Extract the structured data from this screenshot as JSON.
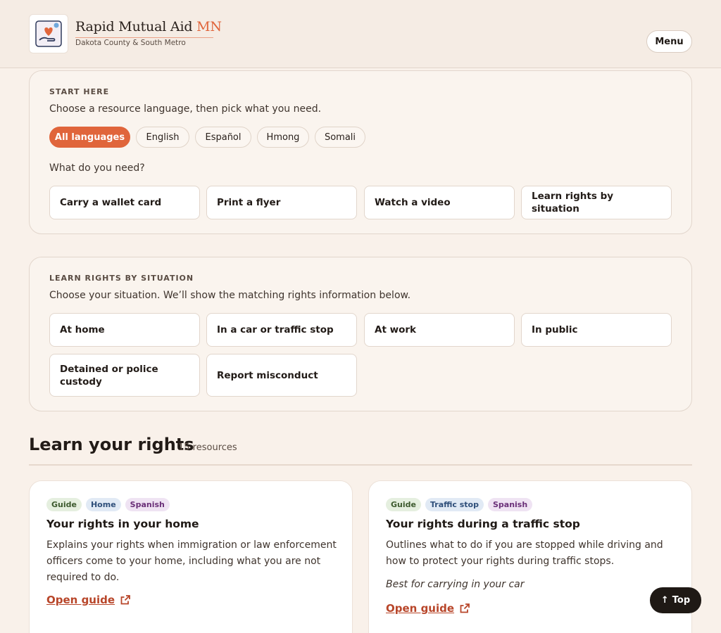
{
  "header": {
    "brand_name": "Rapid Mutual Aid ",
    "brand_accent": "MN",
    "brand_subtitle": "Dakota County & South Metro",
    "menu_label": "Menu",
    "logo_icon": "heart-hand-icon"
  },
  "start_here": {
    "label": "START HERE",
    "instruction": "Choose a resource language, then pick what you need.",
    "languages": [
      {
        "label": "All languages",
        "selected": true
      },
      {
        "label": "English",
        "selected": false
      },
      {
        "label": "Español",
        "selected": false
      },
      {
        "label": "Hmong",
        "selected": false
      },
      {
        "label": "Somali",
        "selected": false
      }
    ],
    "need_prompt": "What do you need?",
    "needs": [
      "Carry a wallet card",
      "Print a flyer",
      "Watch a video",
      "Learn rights by situation"
    ]
  },
  "situation": {
    "label": "LEARN RIGHTS BY SITUATION",
    "instruction": "Choose your situation. We’ll show the matching rights information below.",
    "options": [
      "At home",
      "In a car or traffic stop",
      "At work",
      "In public",
      "Detained or police custody",
      "Report misconduct"
    ]
  },
  "results": {
    "title": "Learn your rights",
    "count": "15 resources",
    "cards": [
      {
        "tags": [
          "Guide",
          "Home",
          "Spanish"
        ],
        "title": "Your rights in your home",
        "description": "Explains your rights when immigration or law enforcement officers come to your home, including what you are not required to do.",
        "note": "",
        "link": "Open guide"
      },
      {
        "tags": [
          "Guide",
          "Traffic stop",
          "Spanish"
        ],
        "title": "Your rights during a traffic stop",
        "description": "Outlines what to do if you are stopped while driving and how to protect your rights during traffic stops.",
        "note": "Best for carrying in your car",
        "link": "Open guide"
      }
    ]
  },
  "top_button": "Top",
  "colors": {
    "accent": "#e0653b",
    "background": "#f9f1ea",
    "link": "#b8462a"
  }
}
